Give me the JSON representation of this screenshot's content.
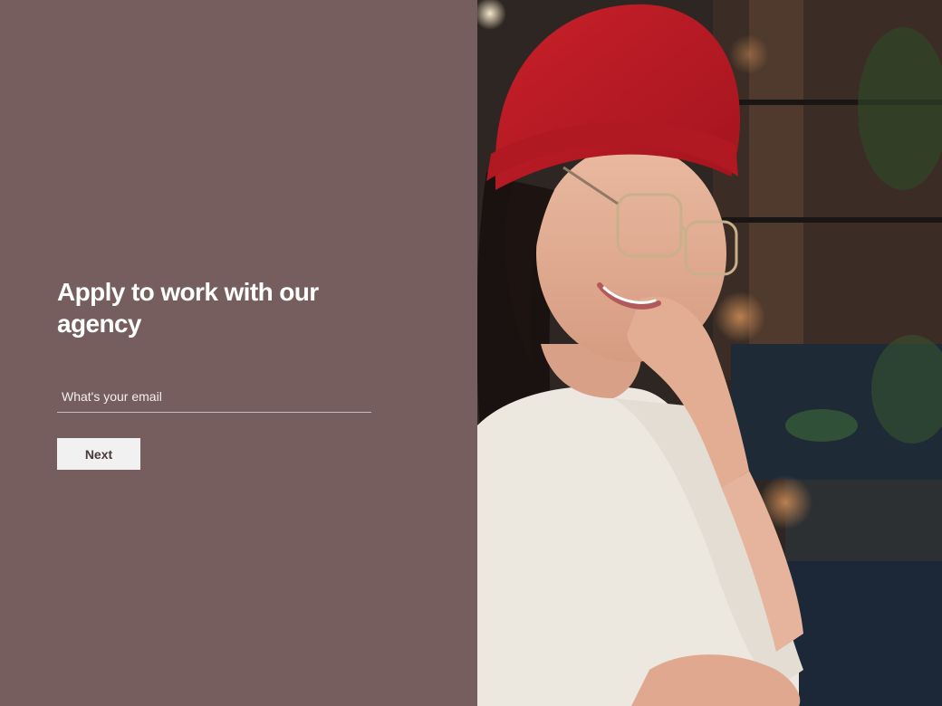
{
  "form": {
    "headline": "Apply to work with our agency",
    "email_placeholder": "What's your email",
    "next_label": "Next"
  },
  "theme": {
    "panel_color": "#765e5e",
    "button_bg": "#f1f1f1"
  },
  "icons": {
    "hero": "photo-of-woman-with-red-beanie"
  }
}
